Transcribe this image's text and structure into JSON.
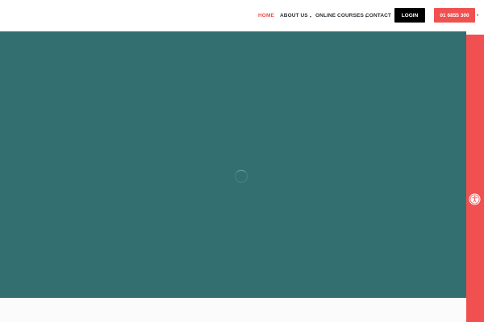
{
  "nav": {
    "items": [
      {
        "label": "HOME",
        "active": true,
        "has_dropdown": false
      },
      {
        "label": "ABOUT US",
        "active": false,
        "has_dropdown": true
      },
      {
        "label": "ONLINE COURSES",
        "active": false,
        "has_dropdown": true
      },
      {
        "label": "CONTACT",
        "active": false,
        "has_dropdown": false
      }
    ],
    "login_label": "LOGIN",
    "phone_label": "01 6855 300"
  },
  "colors": {
    "accent": "#f0504f",
    "hero_background": "#336f71",
    "login_background": "#000000",
    "nav_text": "#2d3338"
  },
  "icons": {
    "accessibility": "accessibility-icon",
    "loading": "loading-spinner-icon"
  }
}
